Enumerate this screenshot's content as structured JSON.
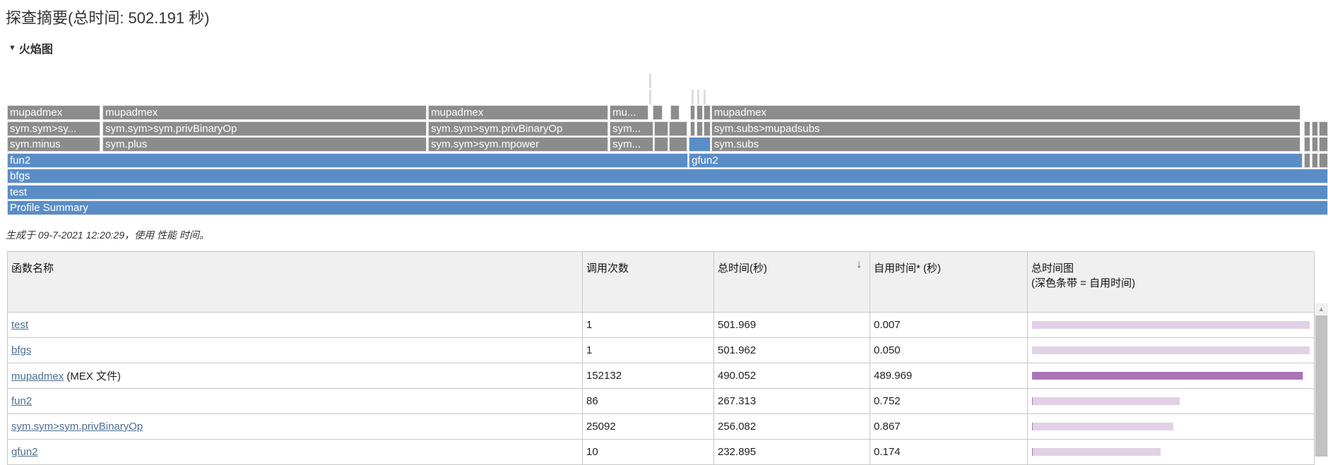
{
  "title": "探查摘要(总时间: 502.191 秒)",
  "section": {
    "label": "火焰图",
    "icon": "triangle-down-icon"
  },
  "flame": {
    "total_s": 502.191,
    "colors": {
      "mex": "#8c8c8c",
      "mfile": "#5a8dc6"
    },
    "frames": [
      {
        "label": "Profile Summary",
        "depth": 0,
        "start_s": 0,
        "dur_s": 502.191,
        "kind": "mfile"
      },
      {
        "label": "test",
        "depth": 1,
        "start_s": 0,
        "dur_s": 502.191,
        "kind": "mfile"
      },
      {
        "label": "bfgs",
        "depth": 2,
        "start_s": 0,
        "dur_s": 502.191,
        "kind": "mfile"
      },
      {
        "label": "fun2",
        "depth": 3,
        "start_s": 0,
        "dur_s": 258.9,
        "kind": "mfile"
      },
      {
        "label": "gfun2",
        "depth": 3,
        "start_s": 259.2,
        "dur_s": 233.4,
        "kind": "mfile"
      },
      {
        "label": "sym.minus",
        "depth": 4,
        "start_s": 0,
        "dur_s": 35.4,
        "kind": "mex"
      },
      {
        "label": "sym.plus",
        "depth": 4,
        "start_s": 36.3,
        "dur_s": 123.3,
        "kind": "mex"
      },
      {
        "label": "sym.sym>sym.mpower",
        "depth": 4,
        "start_s": 160.1,
        "dur_s": 68.5,
        "kind": "mex"
      },
      {
        "label": "sym...",
        "depth": 4,
        "start_s": 229.1,
        "dur_s": 16.6,
        "kind": "mex"
      },
      {
        "label": "",
        "depth": 4,
        "start_s": 245.9,
        "dur_s": 5.6,
        "kind": "mex"
      },
      {
        "label": "",
        "depth": 4,
        "start_s": 251.7,
        "dur_s": 7.0,
        "kind": "mex"
      },
      {
        "label": "",
        "depth": 4,
        "start_s": 259.2,
        "dur_s": 8.3,
        "kind": "mfile"
      },
      {
        "label": "sym.subs",
        "depth": 4,
        "start_s": 267.7,
        "dur_s": 224.0,
        "kind": "mex"
      },
      {
        "label": "sym.sym>sy...",
        "depth": 5,
        "start_s": 0,
        "dur_s": 35.4,
        "kind": "mex"
      },
      {
        "label": "sym.sym>sym.privBinaryOp",
        "depth": 5,
        "start_s": 36.3,
        "dur_s": 123.3,
        "kind": "mex"
      },
      {
        "label": "sym.sym>sym.privBinaryOp",
        "depth": 5,
        "start_s": 160.1,
        "dur_s": 68.5,
        "kind": "mex"
      },
      {
        "label": "sym...",
        "depth": 5,
        "start_s": 229.1,
        "dur_s": 16.6,
        "kind": "mex"
      },
      {
        "label": "",
        "depth": 5,
        "start_s": 245.9,
        "dur_s": 5.6,
        "kind": "mex"
      },
      {
        "label": "",
        "depth": 5,
        "start_s": 251.7,
        "dur_s": 7.0,
        "kind": "mex"
      },
      {
        "label": "",
        "depth": 5,
        "start_s": 259.7,
        "dur_s": 2.0,
        "kind": "mex"
      },
      {
        "label": "",
        "depth": 5,
        "start_s": 262.0,
        "dur_s": 2.4,
        "kind": "mex"
      },
      {
        "label": "",
        "depth": 5,
        "start_s": 264.8,
        "dur_s": 2.6,
        "kind": "mex"
      },
      {
        "label": "sym.subs>mupadsubs",
        "depth": 5,
        "start_s": 267.7,
        "dur_s": 224.0,
        "kind": "mex"
      },
      {
        "label": "mupadmex",
        "depth": 6,
        "start_s": 0,
        "dur_s": 35.4,
        "kind": "mex"
      },
      {
        "label": "mupadmex",
        "depth": 6,
        "start_s": 36.3,
        "dur_s": 123.3,
        "kind": "mex"
      },
      {
        "label": "mupadmex",
        "depth": 6,
        "start_s": 160.1,
        "dur_s": 68.5,
        "kind": "mex"
      },
      {
        "label": "mu...",
        "depth": 6,
        "start_s": 229.1,
        "dur_s": 14.8,
        "kind": "mex"
      },
      {
        "label": "",
        "depth": 6,
        "start_s": 245.4,
        "dur_s": 3.8,
        "kind": "mex"
      },
      {
        "label": "",
        "depth": 6,
        "start_s": 252.2,
        "dur_s": 3.4,
        "kind": "mex"
      },
      {
        "label": "",
        "depth": 6,
        "start_s": 259.7,
        "dur_s": 2.0,
        "kind": "mex"
      },
      {
        "label": "",
        "depth": 6,
        "start_s": 262.0,
        "dur_s": 2.4,
        "kind": "mex"
      },
      {
        "label": "",
        "depth": 6,
        "start_s": 264.8,
        "dur_s": 2.6,
        "kind": "mex"
      },
      {
        "label": "mupadmex",
        "depth": 6,
        "start_s": 267.7,
        "dur_s": 224.0,
        "kind": "mex"
      },
      {
        "label": "",
        "depth": 7,
        "start_s": 244.2,
        "dur_s": 0.8,
        "kind": "mex"
      },
      {
        "label": "",
        "depth": 8,
        "start_s": 244.2,
        "dur_s": 0.5,
        "kind": "mex"
      },
      {
        "label": "",
        "depth": 7,
        "start_s": 260.2,
        "dur_s": 0.8,
        "kind": "mex"
      },
      {
        "label": "",
        "depth": 7,
        "start_s": 262.3,
        "dur_s": 1.2,
        "kind": "mex"
      },
      {
        "label": "",
        "depth": 7,
        "start_s": 264.8,
        "dur_s": 0.8,
        "kind": "mex"
      },
      {
        "label": "",
        "depth": 3,
        "start_s": 493.0,
        "dur_s": 2.6,
        "kind": "mex"
      },
      {
        "label": "",
        "depth": 4,
        "start_s": 493.0,
        "dur_s": 2.6,
        "kind": "mex"
      },
      {
        "label": "",
        "depth": 5,
        "start_s": 493.0,
        "dur_s": 2.6,
        "kind": "mex"
      },
      {
        "label": "",
        "depth": 3,
        "start_s": 496.0,
        "dur_s": 2.4,
        "kind": "mex"
      },
      {
        "label": "",
        "depth": 4,
        "start_s": 496.0,
        "dur_s": 2.4,
        "kind": "mex"
      },
      {
        "label": "",
        "depth": 5,
        "start_s": 496.0,
        "dur_s": 2.4,
        "kind": "mex"
      },
      {
        "label": "",
        "depth": 3,
        "start_s": 498.8,
        "dur_s": 3.39,
        "kind": "mex"
      },
      {
        "label": "",
        "depth": 4,
        "start_s": 498.8,
        "dur_s": 3.39,
        "kind": "mex"
      },
      {
        "label": "",
        "depth": 5,
        "start_s": 498.8,
        "dur_s": 3.39,
        "kind": "mex"
      }
    ]
  },
  "generated": "生成于 09-7-2021 12:20:29，使用 性能 时间。",
  "table": {
    "headers": {
      "name": "函数名称",
      "calls": "调用次数",
      "total": "总时间(秒)",
      "self": "自用时间* (秒)",
      "plot_line1": "总时间图",
      "plot_line2": "(深色条带 = 自用时间)"
    },
    "sort_icon": "sort-arrow-down-icon",
    "bar_colors": {
      "total": "#e2d0e6",
      "self": "#a974b5"
    },
    "rows": [
      {
        "name": "test",
        "suffix": "",
        "calls": "1",
        "total": "501.969",
        "self": "0.007"
      },
      {
        "name": "bfgs",
        "suffix": "",
        "calls": "1",
        "total": "501.962",
        "self": "0.050"
      },
      {
        "name": "mupadmex",
        "suffix": " (MEX 文件)",
        "calls": "152132",
        "total": "490.052",
        "self": "489.969"
      },
      {
        "name": "fun2",
        "suffix": "",
        "calls": "86",
        "total": "267.313",
        "self": "0.752"
      },
      {
        "name": "sym.sym>sym.privBinaryOp",
        "suffix": "",
        "calls": "25092",
        "total": "256.082",
        "self": "0.867"
      },
      {
        "name": "gfun2",
        "suffix": "",
        "calls": "10",
        "total": "232.895",
        "self": "0.174"
      }
    ]
  }
}
